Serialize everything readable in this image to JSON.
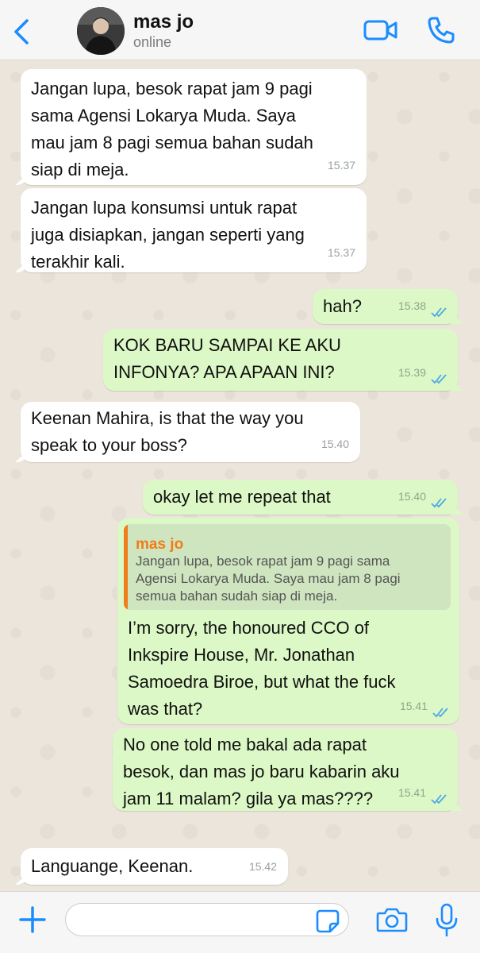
{
  "header": {
    "contact_name": "mas jo",
    "status": "online"
  },
  "colors": {
    "accent": "#1a8cff",
    "outgoing_bubble": "#dcf8c6",
    "incoming_bubble": "#ffffff",
    "quote_name": "#ef7d19"
  },
  "messages": [
    {
      "direction": "in",
      "text": "Jangan lupa, besok rapat jam 9 pagi\nsama Agensi Lokarya Muda. Saya\nmau jam 8 pagi semua bahan sudah\nsiap di meja.",
      "time": "15.37"
    },
    {
      "direction": "in",
      "text": "Jangan lupa konsumsi untuk rapat\njuga disiapkan, jangan seperti yang\nterakhir kali.",
      "time": "15.37"
    },
    {
      "direction": "out",
      "text": "hah?",
      "time": "15.38",
      "status": "read"
    },
    {
      "direction": "out",
      "text": "KOK BARU SAMPAI KE AKU\nINFONYA? APA APAAN INI?",
      "time": "15.39",
      "status": "read"
    },
    {
      "direction": "in",
      "text": "Keenan Mahira, is that the way you\nspeak to your boss?",
      "time": "15.40"
    },
    {
      "direction": "out",
      "text": "okay let me repeat that",
      "time": "15.40",
      "status": "read"
    },
    {
      "direction": "out",
      "reply_to_name": "mas jo",
      "reply_to_text": "Jangan lupa, besok rapat jam 9 pagi sama\nAgensi Lokarya Muda. Saya mau jam 8 pagi\nsemua bahan sudah siap di meja.",
      "text": "I’m sorry, the honoured CCO of\nInkspire House, Mr. Jonathan\nSamoedra Biroe, but what the fuck\nwas that?",
      "time": "15.41",
      "status": "read"
    },
    {
      "direction": "out",
      "text": "No one told me bakal ada rapat\nbesok, dan mas jo baru kabarin aku\njam 11 malam? gila ya mas????",
      "time": "15.41",
      "status": "read"
    },
    {
      "direction": "in",
      "text": "Languange, Keenan.",
      "time": "15.42"
    }
  ],
  "icons": [
    "back-chevron-icon",
    "video-call-icon",
    "phone-call-icon",
    "plus-icon",
    "sticker-icon",
    "camera-icon",
    "microphone-icon"
  ],
  "composer": {
    "value": "",
    "placeholder": ""
  }
}
